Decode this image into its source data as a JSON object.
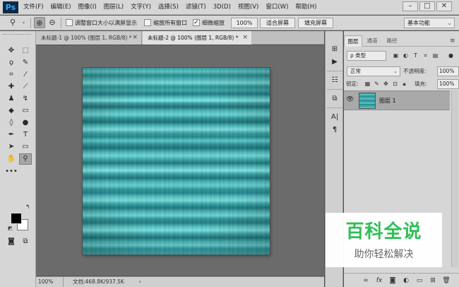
{
  "menubar": {
    "logo": "Ps",
    "menus": [
      "文件(F)",
      "编辑(E)",
      "图像(I)",
      "图层(L)",
      "文字(Y)",
      "选择(S)",
      "滤镜(T)",
      "3D(D)",
      "视图(V)",
      "窗口(W)",
      "帮助(H)"
    ],
    "window_buttons": {
      "minimize": "–",
      "maximize": "□",
      "close": "✕"
    }
  },
  "options": {
    "resize_windows": "调整窗口大小以满屏显示",
    "zoom_all_windows": "缩放所有窗口",
    "scrubby_zoom": "细微缩放",
    "zoom_value": "100%",
    "fit_screen": "适合屏幕",
    "fill_screen": "填充屏幕",
    "workspace": "基本功能",
    "resize_checked": false,
    "zoom_all_checked": false,
    "scrubby_checked": true
  },
  "tabs": [
    {
      "label": "未标题-1 @ 100% (图层 1, RGB/8) *",
      "close": "×"
    },
    {
      "label": "未标题-2 @ 100% (图层 1, RGB/8) *",
      "close": "×"
    }
  ],
  "statusbar": {
    "zoom": "100%",
    "doc": "文档:468.8K/937.5K",
    "arrow": "›"
  },
  "layers_panel": {
    "tabs": [
      "图层",
      "通道",
      "路径"
    ],
    "menu": "≡",
    "filter": "ρ 类型",
    "blend_mode": "正常",
    "opacity_label": "不透明度:",
    "opacity_value": "100%",
    "lock_label": "锁定:",
    "fill_label": "填充:",
    "fill_value": "100%",
    "layer_name": "图层 1",
    "footer_icons": [
      "link-icon",
      "fx-icon",
      "mask-icon",
      "adjustment-icon",
      "group-icon",
      "new-layer-icon",
      "trash-icon"
    ]
  },
  "colors": {
    "foreground": "#000000",
    "background": "#ffffff",
    "canvas_texture": "#3aa7a9"
  },
  "watermark": {
    "title": "百科全说",
    "subtitle": "助你轻松解决"
  }
}
